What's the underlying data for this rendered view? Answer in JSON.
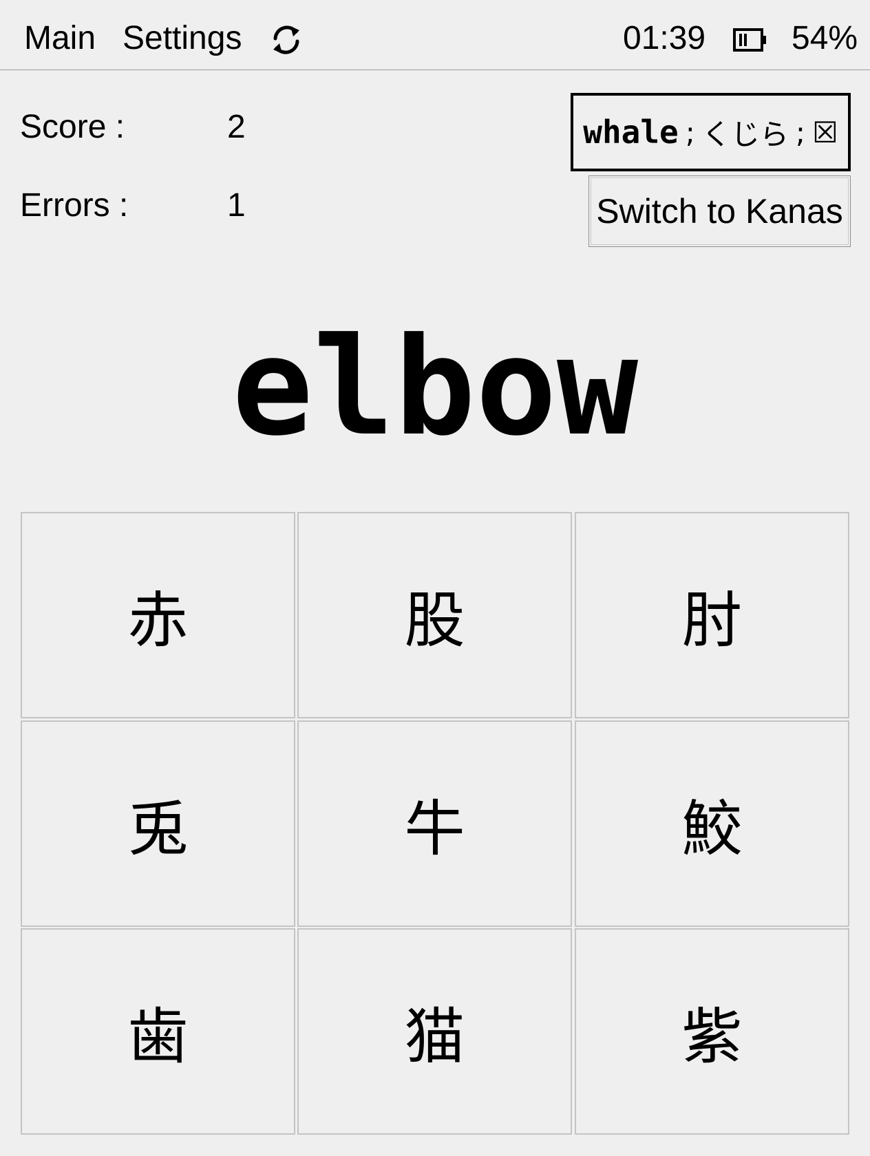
{
  "topbar": {
    "menu_main": "Main",
    "menu_settings": "Settings",
    "sync_icon": "sync-icon",
    "clock": "01:39",
    "battery_icon": "battery-icon",
    "battery_percent": "54%"
  },
  "stats": {
    "score_label": "Score :",
    "score_value": "2",
    "errors_label": "Errors :",
    "errors_value": "1"
  },
  "last_answer": {
    "word": "whale",
    "separator": ";",
    "reading": "くじら",
    "mark": "☒"
  },
  "switch_button": "Switch to Kanas",
  "prompt": "elbow",
  "choices": [
    {
      "char": "赤"
    },
    {
      "char": "股"
    },
    {
      "char": "肘"
    },
    {
      "char": "兎"
    },
    {
      "char": "牛"
    },
    {
      "char": "鮫"
    },
    {
      "char": "歯"
    },
    {
      "char": "猫"
    },
    {
      "char": "紫"
    }
  ]
}
